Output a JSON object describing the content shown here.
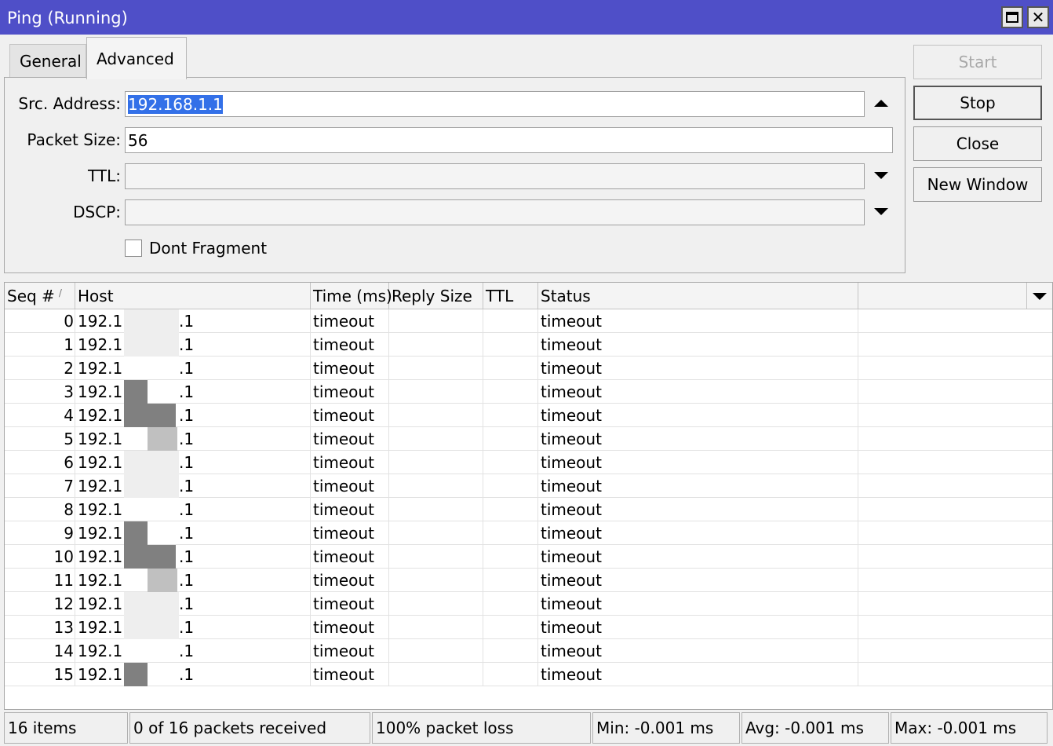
{
  "window": {
    "title": "Ping (Running)"
  },
  "tabs": [
    {
      "label": "General"
    },
    {
      "label": "Advanced"
    }
  ],
  "form": {
    "src_address": {
      "label": "Src. Address:",
      "value": "192.168.1.1"
    },
    "packet_size": {
      "label": "Packet Size:",
      "value": "56"
    },
    "ttl": {
      "label": "TTL:",
      "value": ""
    },
    "dscp": {
      "label": "DSCP:",
      "value": ""
    },
    "dont_fragment": {
      "label": "Dont Fragment",
      "checked": false
    }
  },
  "buttons": {
    "start": "Start",
    "stop": "Stop",
    "close": "Close",
    "new_window": "New Window"
  },
  "table": {
    "columns": [
      "Seq #",
      "Host",
      "Time (ms)",
      "Reply Size",
      "TTL",
      "Status"
    ],
    "rows": [
      {
        "seq": "0",
        "host_pre": "192.1",
        "host_post": ".1",
        "time": "timeout",
        "reply_size": "",
        "ttl": "",
        "status": "timeout"
      },
      {
        "seq": "1",
        "host_pre": "192.1",
        "host_post": ".1",
        "time": "timeout",
        "reply_size": "",
        "ttl": "",
        "status": "timeout"
      },
      {
        "seq": "2",
        "host_pre": "192.1",
        "host_post": ".1",
        "time": "timeout",
        "reply_size": "",
        "ttl": "",
        "status": "timeout"
      },
      {
        "seq": "3",
        "host_pre": "192.1",
        "host_post": ".1",
        "time": "timeout",
        "reply_size": "",
        "ttl": "",
        "status": "timeout"
      },
      {
        "seq": "4",
        "host_pre": "192.1",
        "host_post": ".1",
        "time": "timeout",
        "reply_size": "",
        "ttl": "",
        "status": "timeout"
      },
      {
        "seq": "5",
        "host_pre": "192.1",
        "host_post": ".1",
        "time": "timeout",
        "reply_size": "",
        "ttl": "",
        "status": "timeout"
      },
      {
        "seq": "6",
        "host_pre": "192.1",
        "host_post": ".1",
        "time": "timeout",
        "reply_size": "",
        "ttl": "",
        "status": "timeout"
      },
      {
        "seq": "7",
        "host_pre": "192.1",
        "host_post": ".1",
        "time": "timeout",
        "reply_size": "",
        "ttl": "",
        "status": "timeout"
      },
      {
        "seq": "8",
        "host_pre": "192.1",
        "host_post": ".1",
        "time": "timeout",
        "reply_size": "",
        "ttl": "",
        "status": "timeout"
      },
      {
        "seq": "9",
        "host_pre": "192.1",
        "host_post": ".1",
        "time": "timeout",
        "reply_size": "",
        "ttl": "",
        "status": "timeout"
      },
      {
        "seq": "10",
        "host_pre": "192.1",
        "host_post": ".1",
        "time": "timeout",
        "reply_size": "",
        "ttl": "",
        "status": "timeout"
      },
      {
        "seq": "11",
        "host_pre": "192.1",
        "host_post": ".1",
        "time": "timeout",
        "reply_size": "",
        "ttl": "",
        "status": "timeout"
      },
      {
        "seq": "12",
        "host_pre": "192.1",
        "host_post": ".1",
        "time": "timeout",
        "reply_size": "",
        "ttl": "",
        "status": "timeout"
      },
      {
        "seq": "13",
        "host_pre": "192.1",
        "host_post": ".1",
        "time": "timeout",
        "reply_size": "",
        "ttl": "",
        "status": "timeout"
      },
      {
        "seq": "14",
        "host_pre": "192.1",
        "host_post": ".1",
        "time": "timeout",
        "reply_size": "",
        "ttl": "",
        "status": "timeout"
      },
      {
        "seq": "15",
        "host_pre": "192.1",
        "host_post": ".1",
        "time": "timeout",
        "reply_size": "",
        "ttl": "",
        "status": "timeout"
      }
    ]
  },
  "status_bar": {
    "items": "16 items",
    "received": "0 of 16 packets received",
    "loss": "100% packet loss",
    "min": "Min: -0.001 ms",
    "avg": "Avg: -0.001 ms",
    "max": "Max: -0.001 ms"
  },
  "colors": {
    "titlebar": "#4f4fc8",
    "selection": "#3370e8"
  }
}
